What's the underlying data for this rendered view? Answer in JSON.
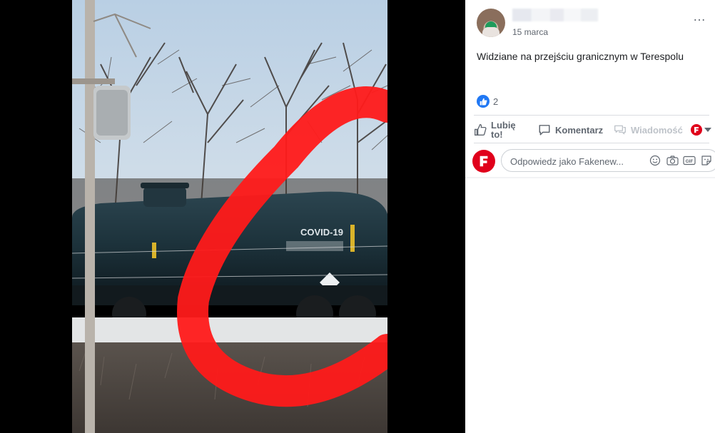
{
  "photo": {
    "tank_marking": "COVID-19",
    "highlight_color": "#ff1a1a"
  },
  "post": {
    "date": "15 marca",
    "text": "Widziane na przejściu granicznym w Terespolu",
    "reaction_count": "2",
    "more_icon": "…"
  },
  "actions": {
    "like_line1": "Lubię",
    "like_line2": "to!",
    "comment": "Komentarz",
    "message": "Wiadomość"
  },
  "comment": {
    "placeholder": "Odpowiedz jako Fakenew..."
  },
  "colors": {
    "brand_red": "#e0001b",
    "like_blue": "#2078f4",
    "text_secondary": "#606770"
  },
  "icons": [
    "thumbs-up-icon",
    "comment-icon",
    "messenger-icon",
    "caret-down-icon",
    "emoji-icon",
    "camera-icon",
    "gif-icon",
    "sticker-icon",
    "more-icon"
  ]
}
